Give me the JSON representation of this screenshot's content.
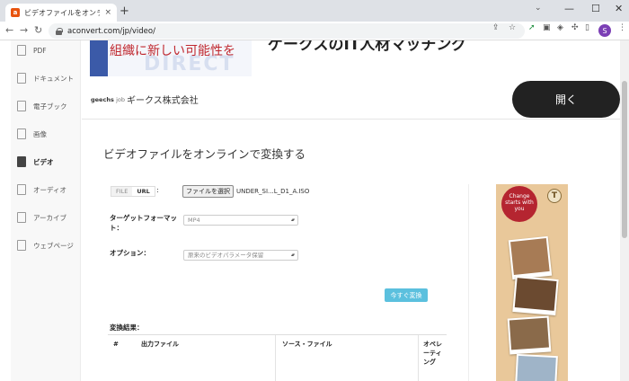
{
  "browser": {
    "tab_title": "ビデオファイルをオンラインで変換する",
    "tab_close": "×",
    "new_tab": "+",
    "tab_search": "⌄",
    "url": "aconvert.com/jp/video/",
    "profile_initial": "S",
    "window": {
      "minimize": "—",
      "maximize": "☐",
      "close": "✕"
    }
  },
  "nav": {
    "back": "←",
    "forward": "→",
    "reload": "↻"
  },
  "sidebar": {
    "items": [
      {
        "label": "PDF",
        "active": false
      },
      {
        "label": "ドキュメント",
        "active": false
      },
      {
        "label": "電子ブック",
        "active": false
      },
      {
        "label": "画像",
        "active": false
      },
      {
        "label": "ビデオ",
        "active": true
      },
      {
        "label": "オーディオ",
        "active": false
      },
      {
        "label": "アーカイブ",
        "active": false
      },
      {
        "label": "ウェブページ",
        "active": false
      }
    ]
  },
  "banner": {
    "catchphrase": "組織に新しい可能性を",
    "ghost_text": "DIRECT",
    "cut_heading": "ゲークスのIT人材マッチング"
  },
  "ad": {
    "logo": "geechs",
    "logo_suffix": "job",
    "company": "ギークス株式会社",
    "open_button": "開く"
  },
  "main": {
    "title": "ビデオファイルをオンラインで変換する",
    "source": {
      "file_tab": "FILE",
      "url_tab": "URL",
      "colon": ":"
    },
    "choose_button": "ファイルを選択",
    "chosen_file": "UNDER_SI...L_D1_A.ISO",
    "target_label": "ターゲットフォーマット：",
    "target_value": "MP4",
    "option_label": "オプション：",
    "option_value": "原来のビデオパラメータ保留",
    "convert_button": "今すぐ変換"
  },
  "results": {
    "heading": "変換結果：",
    "columns": [
      "#",
      "出力ファイル",
      "ソース・ファイル",
      "オペレーティング"
    ]
  },
  "right_ad": {
    "badge_text": "Change starts with you",
    "logo_mark": "T"
  }
}
